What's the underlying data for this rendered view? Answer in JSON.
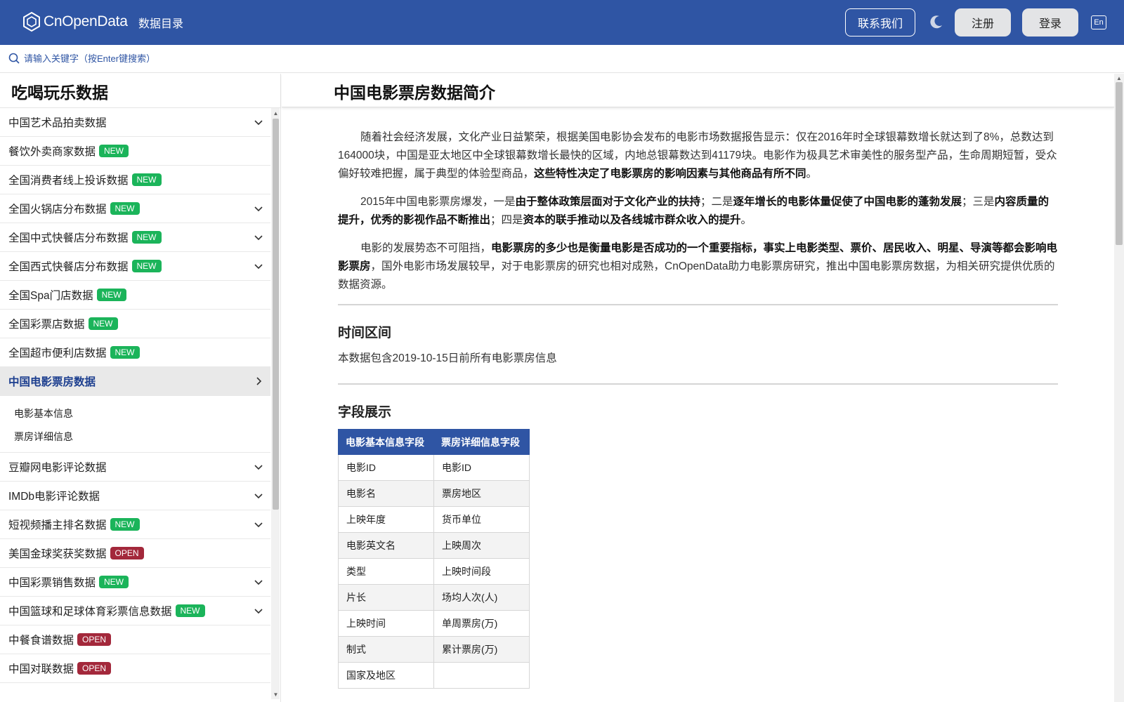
{
  "header": {
    "brand": "CnOpenData",
    "nav_catalog": "数据目录",
    "contact": "联系我们",
    "register": "注册",
    "login": "登录",
    "lang": "En"
  },
  "search": {
    "placeholder": "请输入关键字（按Enter键搜索）"
  },
  "sidebar": {
    "title": "吃喝玩乐数据",
    "items": [
      {
        "label": "中国艺术品拍卖数据",
        "badge": "",
        "chevron": "down"
      },
      {
        "label": "餐饮外卖商家数据",
        "badge": "NEW",
        "chevron": ""
      },
      {
        "label": "全国消费者线上投诉数据",
        "badge": "NEW",
        "chevron": ""
      },
      {
        "label": "全国火锅店分布数据",
        "badge": "NEW",
        "chevron": "down"
      },
      {
        "label": "全国中式快餐店分布数据",
        "badge": "NEW",
        "chevron": "down"
      },
      {
        "label": "全国西式快餐店分布数据",
        "badge": "NEW",
        "chevron": "down"
      },
      {
        "label": "全国Spa门店数据",
        "badge": "NEW",
        "chevron": ""
      },
      {
        "label": "全国彩票店数据",
        "badge": "NEW",
        "chevron": ""
      },
      {
        "label": "全国超市便利店数据",
        "badge": "NEW",
        "chevron": ""
      },
      {
        "label": "中国电影票房数据",
        "badge": "",
        "chevron": "right",
        "active": true
      },
      {
        "label": "豆瓣网电影评论数据",
        "badge": "",
        "chevron": "down"
      },
      {
        "label": "IMDb电影评论数据",
        "badge": "",
        "chevron": "down"
      },
      {
        "label": "短视频播主排名数据",
        "badge": "NEW",
        "chevron": "down"
      },
      {
        "label": "美国金球奖获奖数据",
        "badge": "OPEN",
        "chevron": ""
      },
      {
        "label": "中国彩票销售数据",
        "badge": "NEW",
        "chevron": "down"
      },
      {
        "label": "中国篮球和足球体育彩票信息数据",
        "badge": "NEW",
        "chevron": "down"
      },
      {
        "label": "中餐食谱数据",
        "badge": "OPEN",
        "chevron": ""
      },
      {
        "label": "中国对联数据",
        "badge": "OPEN",
        "chevron": ""
      }
    ],
    "sub_items": [
      "电影基本信息",
      "票房详细信息"
    ]
  },
  "main": {
    "title": "中国电影票房数据简介",
    "para1_a": "随着社会经济发展，文化产业日益繁荣，根据美国电影协会发布的电影市场数据报告显示：仅在2016年时全球银幕数增长就达到了8%，总数达到164000块，中国是亚太地区中全球银幕数增长最快的区域，内地总银幕数达到41179块。电影作为极具艺术审美性的服务型产品，生命周期短暂，受众偏好较难把握，属于典型的体验型商品，",
    "para1_b": "这些特性决定了电影票房的影响因素与其他商品有所不同",
    "para1_c": "。",
    "para2_a": "2015年中国电影票房爆发，一是",
    "para2_b": "由于整体政策层面对于文化产业的扶持",
    "para2_c": "；二是",
    "para2_d": "逐年增长的电影体量促使了中国电影的蓬勃发展",
    "para2_e": "；三是",
    "para2_f": "内容质量的提升，优秀的影视作品不断推出",
    "para2_g": "；四是",
    "para2_h": "资本的联手推动以及各线城市群众收入的提升",
    "para2_i": "。",
    "para3_a": "电影的发展势态不可阻挡，",
    "para3_b": "电影票房的多少也是衡量电影是否成功的一个重要指标，事实上电影类型、票价、居民收入、明星、导演等都会影响电影票房",
    "para3_c": "，国外电影市场发展较早，对于电影票房的研究也相对成熟，CnOpenData助力电影票房研究，推出中国电影票房数据，为相关研究提供优质的数据资源。",
    "section_time_title": "时间区间",
    "section_time_text": "本数据包含2019-10-15日前所有电影票房信息",
    "section_fields_title": "字段展示",
    "table": {
      "headers": [
        "电影基本信息字段",
        "票房详细信息字段"
      ],
      "rows": [
        [
          "电影ID",
          "电影ID"
        ],
        [
          "电影名",
          "票房地区"
        ],
        [
          "上映年度",
          "货币单位"
        ],
        [
          "电影英文名",
          "上映周次"
        ],
        [
          "类型",
          "上映时间段"
        ],
        [
          "片长",
          "场均人次(人)"
        ],
        [
          "上映时间",
          "单周票房(万)"
        ],
        [
          "制式",
          "累计票房(万)"
        ],
        [
          "国家及地区",
          ""
        ]
      ]
    }
  },
  "colors": {
    "brand": "#2f55a4",
    "badge_new": "#1bb45a",
    "badge_open": "#a3283b"
  }
}
